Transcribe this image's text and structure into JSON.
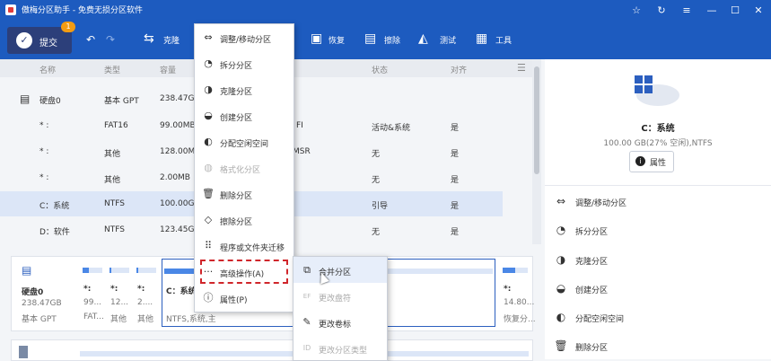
{
  "app": {
    "title": "傲梅分区助手 - 免费无损分区软件"
  },
  "toolbar": {
    "commit_label": "提交",
    "commit_badge": "1",
    "clone_label": "克隆",
    "restore_label": "恢复",
    "wipe_label": "擦除",
    "test_label": "测试",
    "tools_label": "工具"
  },
  "list": {
    "headers": [
      "名称",
      "类型",
      "容量",
      "状态",
      "对齐"
    ],
    "rows": [
      {
        "name": "硬盘0",
        "type": "基本 GPT",
        "cap": "238.47GB",
        "fs": "",
        "status": "",
        "align": ""
      },
      {
        "name": "* :",
        "type": "FAT16",
        "cap": "99.00MB",
        "fs": "FI",
        "status": "活动&系统",
        "align": "是"
      },
      {
        "name": "* :",
        "type": "其他",
        "cap": "128.00MB",
        "fs": "MSR",
        "status": "无",
        "align": "是"
      },
      {
        "name": "* :",
        "type": "其他",
        "cap": "2.00MB",
        "fs": "",
        "status": "无",
        "align": "是"
      },
      {
        "name": "C：系统",
        "type": "NTFS",
        "cap": "100.00GB",
        "fs": "",
        "status": "引导",
        "align": "是"
      },
      {
        "name": "D：软件",
        "type": "NTFS",
        "cap": "123.45GB",
        "fs": "",
        "status": "无",
        "align": "是"
      }
    ]
  },
  "disk": {
    "name": "硬盘0",
    "size": "238.47GB",
    "type": "基本 GPT",
    "segments": [
      {
        "l1": "*:",
        "l2": "99...",
        "l3": "FAT...",
        "fill": 0.3
      },
      {
        "l1": "*:",
        "l2": "12...",
        "l3": "其他",
        "fill": 0.1
      },
      {
        "l1": "*:",
        "l2": "2....",
        "l3": "其他",
        "fill": 0.1
      },
      {
        "l1": "C：系统",
        "l2": "",
        "l3": "NTFS,系统,主",
        "fill": 0.27
      },
      {
        "l1": "*:",
        "l2": "14.80...",
        "l3": "恢复分...",
        "fill": 0.5
      }
    ]
  },
  "right_panel": {
    "title": "C：系统",
    "subtitle": "100.00 GB(27% 空闲),NTFS",
    "properties_label": "属性",
    "items": [
      {
        "icon": "move-resize-icon",
        "label": "调整/移动分区"
      },
      {
        "icon": "split-icon",
        "label": "拆分分区"
      },
      {
        "icon": "clone-icon",
        "label": "克隆分区"
      },
      {
        "icon": "create-icon",
        "label": "创建分区"
      },
      {
        "icon": "allocate-icon",
        "label": "分配空闲空间"
      },
      {
        "icon": "delete-icon",
        "label": "删除分区"
      }
    ]
  },
  "context_menu": {
    "items": [
      {
        "label": "调整/移动分区",
        "disabled": false
      },
      {
        "label": "拆分分区",
        "disabled": false
      },
      {
        "label": "克隆分区",
        "disabled": false
      },
      {
        "label": "创建分区",
        "disabled": false
      },
      {
        "label": "分配空闲空间",
        "disabled": false
      },
      {
        "label": "格式化分区",
        "disabled": true
      },
      {
        "label": "删除分区",
        "disabled": false
      },
      {
        "label": "擦除分区",
        "disabled": false
      },
      {
        "label": "程序或文件夹迁移",
        "disabled": false
      },
      {
        "label": "高级操作(A)",
        "disabled": false
      },
      {
        "label": "属性(P)",
        "disabled": false
      }
    ]
  },
  "submenu": {
    "items": [
      {
        "label": "合并分区",
        "disabled": false
      },
      {
        "label": "更改盘符",
        "disabled": true
      },
      {
        "label": "更改卷标",
        "disabled": false
      },
      {
        "label": "更改分区类型",
        "disabled": true
      }
    ]
  }
}
